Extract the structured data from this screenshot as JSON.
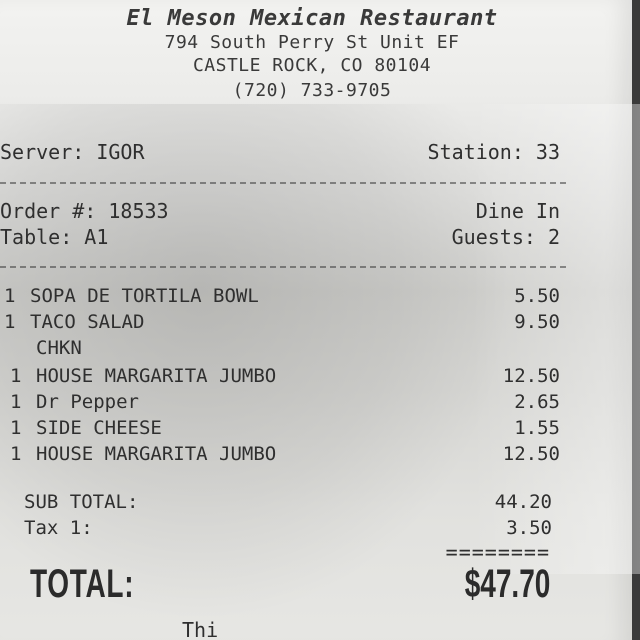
{
  "restaurant": {
    "name": "El Meson Mexican Restaurant",
    "address_line1": "794 South Perry St Unit EF",
    "address_line2": "CASTLE ROCK, CO 80104",
    "phone": "(720) 733-9705"
  },
  "meta": {
    "server_label": "Server: IGOR",
    "station_label": "Station: 33",
    "order_label": "Order #: 18533",
    "service_type": "Dine In",
    "table_label": "Table: A1",
    "guests_label": "Guests: 2"
  },
  "items": [
    {
      "qty": "1",
      "name": "SOPA DE TORTILA BOWL",
      "price": "5.50"
    },
    {
      "qty": "1",
      "name": "TACO SALAD",
      "price": "9.50"
    },
    {
      "qty": "",
      "name": "CHKN",
      "price": ""
    },
    {
      "qty": "1",
      "name": "HOUSE MARGARITA JUMBO",
      "price": "12.50"
    },
    {
      "qty": "1",
      "name": "Dr Pepper",
      "price": "2.65"
    },
    {
      "qty": "1",
      "name": "SIDE CHEESE",
      "price": "1.55"
    },
    {
      "qty": "1",
      "name": "HOUSE MARGARITA JUMBO",
      "price": "12.50"
    }
  ],
  "totals": {
    "subtotal_label": "SUB TOTAL:",
    "subtotal_value": "44.20",
    "tax_label": "Tax 1:",
    "tax_value": "3.50",
    "equals_rule": "========",
    "total_label": "TOTAL:",
    "total_value": "$47.70"
  },
  "footer": {
    "cut_text": "Thi"
  }
}
